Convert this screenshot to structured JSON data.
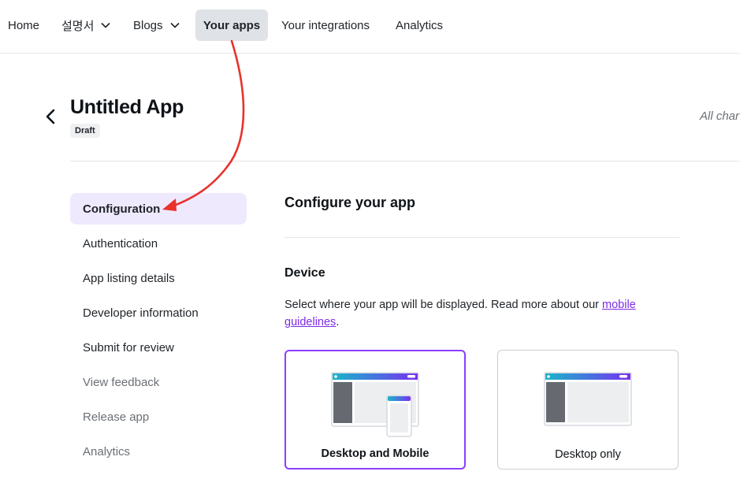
{
  "nav": {
    "items": [
      {
        "label": "Home"
      },
      {
        "label": "설명서",
        "has_chevron": true
      },
      {
        "label": "Blogs",
        "has_chevron": true
      },
      {
        "label": "Your apps",
        "active": true
      },
      {
        "label": "Your integrations"
      },
      {
        "label": "Analytics"
      }
    ]
  },
  "header": {
    "title": "Untitled App",
    "badge": "Draft",
    "note": "All char"
  },
  "sidebar": {
    "items": [
      {
        "label": "Configuration",
        "active": true
      },
      {
        "label": "Authentication"
      },
      {
        "label": "App listing details"
      },
      {
        "label": "Developer information"
      },
      {
        "label": "Submit for review"
      },
      {
        "label": "View feedback",
        "muted": true
      },
      {
        "label": "Release app",
        "muted": true
      },
      {
        "label": "Analytics",
        "muted": true
      }
    ]
  },
  "main": {
    "title": "Configure your app",
    "device": {
      "title": "Device",
      "description": "Select where your app will be displayed. Read more about our ",
      "link": "mobile guidelines",
      "description_end": ".",
      "options": [
        {
          "label": "Desktop and Mobile",
          "selected": true
        },
        {
          "label": "Desktop only",
          "selected": false
        }
      ]
    }
  },
  "colors": {
    "accent": "#8b3dff",
    "link": "#7d2ae8",
    "annotation_arrow": "#e8322b",
    "active_menu_bg": "#efe9fe",
    "active_nav_bg": "#dfe2e6"
  }
}
